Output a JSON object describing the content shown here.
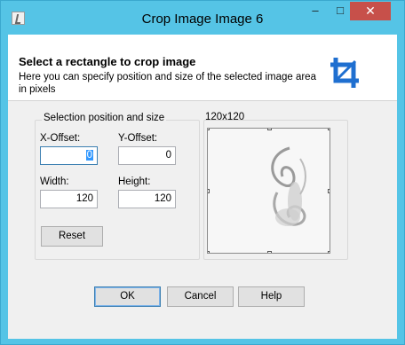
{
  "window": {
    "title": "Crop Image Image 6",
    "minimize_glyph": "–",
    "maximize_glyph": "□",
    "close_glyph": "✕"
  },
  "header": {
    "title": "Select a rectangle to crop image",
    "description": "Here you can specify position and size of the selected image area in pixels",
    "icon": "crop-icon"
  },
  "selection": {
    "group_title": "Selection position and size",
    "x_offset": {
      "label": "X-Offset:",
      "value": "0"
    },
    "y_offset": {
      "label": "Y-Offset:",
      "value": "0"
    },
    "width": {
      "label": "Width:",
      "value": "120"
    },
    "height": {
      "label": "Height:",
      "value": "120"
    },
    "reset_label": "Reset"
  },
  "preview": {
    "size_label": "120x120"
  },
  "footer": {
    "ok_label": "OK",
    "cancel_label": "Cancel",
    "help_label": "Help"
  },
  "colors": {
    "titlebar": "#55c4e6",
    "close_button": "#c7504a",
    "crop_icon": "#1f6fd0"
  }
}
